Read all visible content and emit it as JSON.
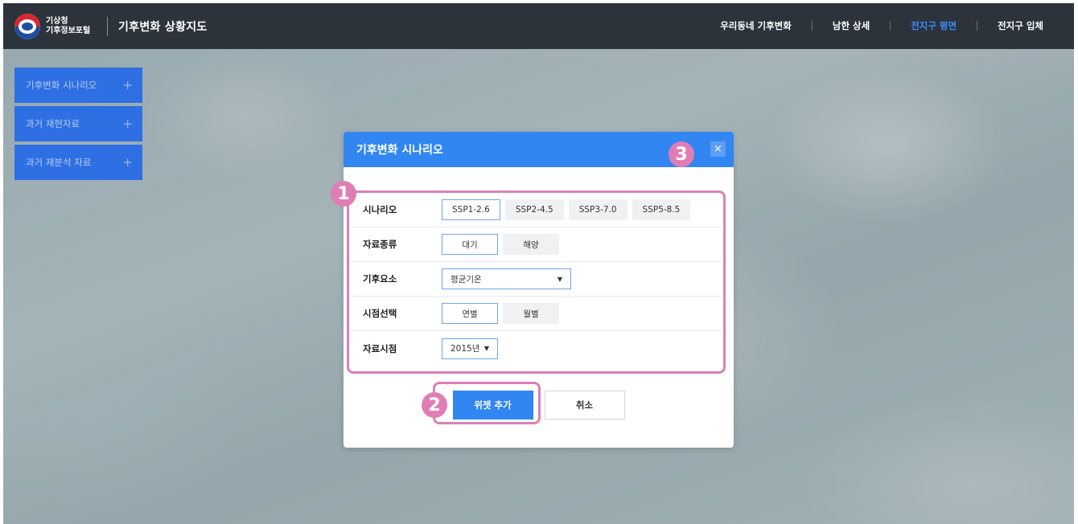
{
  "header": {
    "logo_line1": "기상청",
    "logo_line2": "기후정보포털",
    "app_title": "기후변화 상황지도",
    "nav": [
      {
        "label": "우리동네 기후변화",
        "active": false
      },
      {
        "label": "남한 상세",
        "active": false
      },
      {
        "label": "전지구 평면",
        "active": true
      },
      {
        "label": "전지구 입체",
        "active": false
      }
    ]
  },
  "sidebar": {
    "items": [
      {
        "label": "기후변화 시나리오",
        "icon": "plus-icon"
      },
      {
        "label": "과거 재현자료",
        "icon": "plus-icon"
      },
      {
        "label": "과거 재분석 자료",
        "icon": "plus-icon"
      }
    ],
    "plus_glyph": "+"
  },
  "dialog": {
    "title": "기후변화 시나리오",
    "close_glyph": "×",
    "rows": {
      "scenario": {
        "label": "시나리오",
        "options": [
          "SSP1-2.6",
          "SSP2-4.5",
          "SSP3-7.0",
          "SSP5-8.5"
        ],
        "selected": "SSP1-2.6"
      },
      "data_type": {
        "label": "자료종류",
        "options": [
          "대기",
          "해양"
        ],
        "selected": "대기"
      },
      "element": {
        "label": "기후요소",
        "value": "평균기온"
      },
      "period": {
        "label": "시점선택",
        "options": [
          "연별",
          "월별"
        ],
        "selected": "연별"
      },
      "time": {
        "label": "자료시점",
        "value": "2015년"
      }
    },
    "add_button": "위젯 추가",
    "cancel_button": "취소"
  },
  "annotations": {
    "badge1": "1",
    "badge2": "2",
    "badge3": "3"
  },
  "colors": {
    "header_bg": "#2c333b",
    "accent": "#3186f2",
    "active_nav": "#3e8bf6",
    "annotation": "#df7eb5"
  }
}
